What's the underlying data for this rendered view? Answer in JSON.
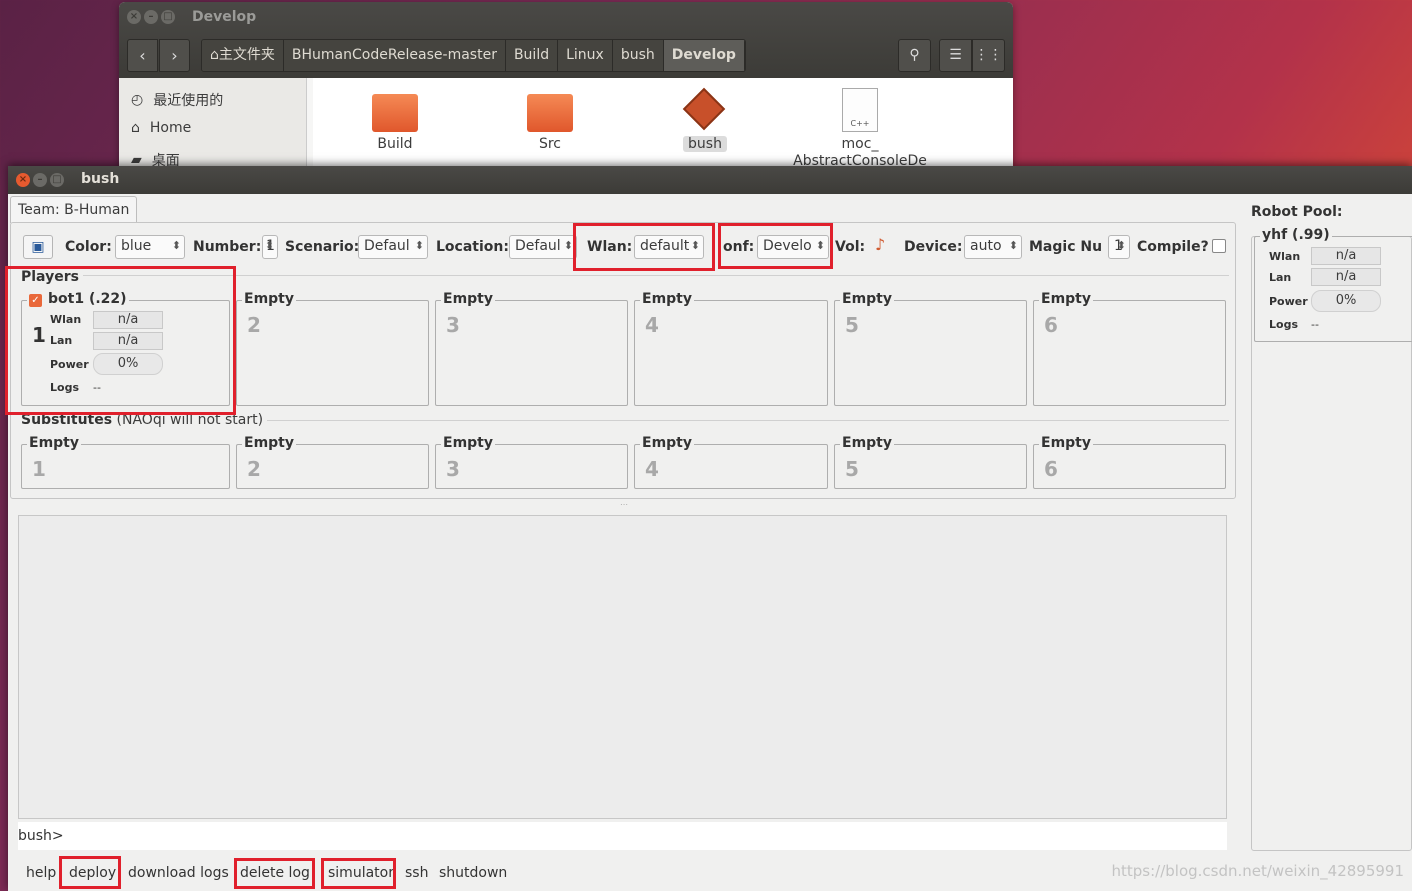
{
  "file_manager": {
    "title": "Develop",
    "breadcrumbs": [
      "⌂主文件夹",
      "BHumanCodeRelease-master",
      "Build",
      "Linux",
      "bush",
      "Develop"
    ],
    "sidebar": [
      {
        "icon": "clock-icon",
        "label": "最近使用的"
      },
      {
        "icon": "home-icon",
        "label": "Home"
      },
      {
        "icon": "folder-icon",
        "label": "桌面"
      }
    ],
    "files": [
      {
        "name": "Build",
        "icon": "folder-icon"
      },
      {
        "name": "Src",
        "icon": "folder-icon"
      },
      {
        "name": "bush",
        "icon": "diamond-executable-icon"
      },
      {
        "name": "moc_\nAbstractConsoleDe",
        "icon": "cpp-file-icon"
      }
    ]
  },
  "bush": {
    "title": "bush",
    "tab": "Team: B-Human",
    "toolbar": {
      "color_label": "Color:",
      "color_value": "blue",
      "number_label": "Number:",
      "number_value": "1",
      "scenario_label": "Scenario:",
      "scenario_value": "Defaul",
      "location_label": "Location:",
      "location_value": "Defaul",
      "wlan_label": "Wlan:",
      "wlan_value": "default",
      "conf_label": "onf:",
      "conf_value": "Develo",
      "vol_label": "Vol:",
      "device_label": "Device:",
      "device_value": "auto",
      "magic_label": "Magic Nun",
      "magic_value": "1",
      "compile_label": "Compile?"
    },
    "players_label": "Players",
    "players": [
      {
        "title": "bot1 (.22)",
        "num": "1",
        "wlan": "n/a",
        "lan": "n/a",
        "power": "0%",
        "logs": "--"
      },
      {
        "title": "Empty",
        "num": "2"
      },
      {
        "title": "Empty",
        "num": "3"
      },
      {
        "title": "Empty",
        "num": "4"
      },
      {
        "title": "Empty",
        "num": "5"
      },
      {
        "title": "Empty",
        "num": "6"
      }
    ],
    "subs_label": "Substitutes",
    "subs_note": "(NAOqi will not start)",
    "subs": [
      {
        "title": "Empty",
        "num": "1"
      },
      {
        "title": "Empty",
        "num": "2"
      },
      {
        "title": "Empty",
        "num": "3"
      },
      {
        "title": "Empty",
        "num": "4"
      },
      {
        "title": "Empty",
        "num": "5"
      },
      {
        "title": "Empty",
        "num": "6"
      }
    ],
    "field_labels": {
      "wlan": "Wlan",
      "lan": "Lan",
      "power": "Power",
      "logs": "Logs"
    },
    "prompt": "bush>",
    "commands": [
      "help",
      "deploy",
      "download logs",
      "delete log",
      "simulator",
      "ssh",
      "shutdown"
    ],
    "pool": {
      "label": "Robot Pool:",
      "robot": "yhf (.99)",
      "wlan": "n/a",
      "lan": "n/a",
      "power": "0%",
      "logs": "--"
    }
  },
  "watermark": "https://blog.csdn.net/weixin_42895991"
}
